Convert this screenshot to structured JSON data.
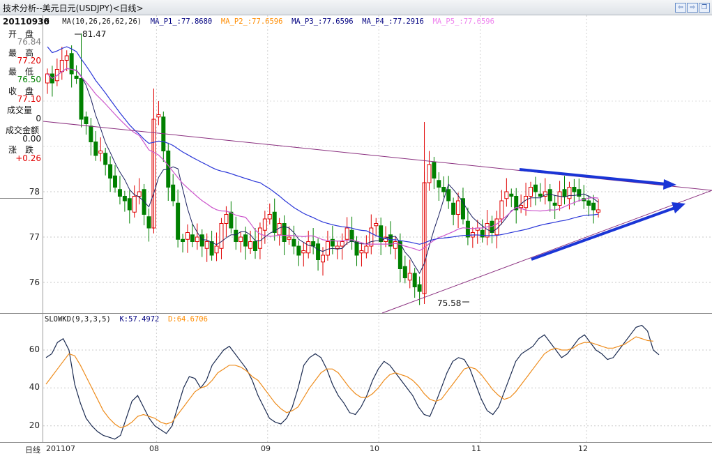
{
  "window": {
    "title": "技术分析--美元日元(USDJPY)<日线>",
    "nav_prev": "⇦",
    "nav_next": "⇨",
    "nav_restore": "❐"
  },
  "info_panel": {
    "date": "20110930",
    "rows": [
      {
        "label": "开　盘",
        "value": "76.84",
        "color": "#808080"
      },
      {
        "label": "最　高",
        "value": "77.20",
        "color": "#e00000"
      },
      {
        "label": "最　低",
        "value": "76.50",
        "color": "#008000"
      },
      {
        "label": "收　盘",
        "value": "77.10",
        "color": "#e00000"
      },
      {
        "label": "成交量",
        "value": "0",
        "color": "#111111"
      },
      {
        "label": "成交金额",
        "value": "0.00",
        "color": "#111111"
      },
      {
        "label": "涨　跌",
        "value": "+0.26",
        "color": "#e00000"
      }
    ]
  },
  "price_legend": {
    "k": "K",
    "ma_params": "MA(10,26,26,62,26)",
    "items": [
      {
        "text": "MA_P1_:77.8680",
        "color": "#000080"
      },
      {
        "text": "MA_P2_:77.6596",
        "color": "#ff8c00"
      },
      {
        "text": "MA_P3_:77.6596",
        "color": "#000080"
      },
      {
        "text": "MA_P4_:77.2916",
        "color": "#000080"
      },
      {
        "text": "MA_P5_:77.6596",
        "color": "#ee82ee"
      }
    ]
  },
  "kd_legend": {
    "params": "SLOWKD(9,3,3,5)",
    "k_text": "K:57.4972",
    "d_text": "D:64.6706",
    "k_color": "#000080",
    "d_color": "#ff8c00"
  },
  "y_ticks_price": [
    "78",
    "77",
    "76"
  ],
  "y_ticks_kd": [
    "60",
    "40",
    "20"
  ],
  "x_axis": {
    "period_label": "日线",
    "labels": [
      "201107",
      "08",
      "09",
      "10",
      "11",
      "12"
    ]
  },
  "annotations": {
    "high_label": "81.47",
    "low_label": "75.58"
  },
  "colors": {
    "up": "#e00000",
    "down": "#008000",
    "ma_fast": "#1a2060",
    "ma_slow": "#2a36d8",
    "ma_mid": "#cc55cc",
    "trend": "#8a2f7f",
    "arrow": "#1a35d6",
    "k_line": "#1a2a50",
    "d_line": "#ee8c1c"
  },
  "chart_data": [
    {
      "type": "candlestick",
      "ylim": [
        75.3,
        81.5
      ],
      "x_months": [
        "201107",
        "08",
        "09",
        "10",
        "11",
        "12"
      ],
      "month_start_index": [
        0,
        23,
        46,
        69,
        90,
        112
      ],
      "series": [
        {
          "name": "MA_P1_",
          "last": 77.868
        },
        {
          "name": "MA_P2_",
          "last": 77.6596
        },
        {
          "name": "MA_P3_",
          "last": 77.6596
        },
        {
          "name": "MA_P4_",
          "last": 77.2916
        },
        {
          "name": "MA_P5_",
          "last": 77.6596
        }
      ],
      "closes": [
        80.6,
        80.4,
        80.7,
        80.9,
        81.0,
        80.6,
        80.5,
        79.6,
        79.5,
        79.1,
        78.8,
        78.9,
        78.6,
        78.3,
        78.1,
        77.9,
        77.8,
        77.6,
        77.9,
        78.0,
        77.5,
        77.2,
        79.6,
        79.7,
        78.9,
        78.1,
        77.8,
        76.95,
        76.9,
        77.1,
        76.9,
        77.0,
        76.8,
        76.9,
        76.6,
        76.8,
        77.3,
        77.5,
        77.2,
        76.9,
        77.0,
        76.8,
        76.9,
        76.7,
        77.2,
        77.4,
        77.5,
        77.1,
        77.3,
        76.9,
        77.0,
        76.8,
        76.6,
        76.7,
        76.9,
        76.8,
        76.5,
        76.6,
        76.9,
        76.8,
        76.8,
        76.9,
        77.2,
        76.9,
        76.6,
        76.7,
        76.8,
        77.2,
        77.3,
        76.9,
        77.0,
        76.8,
        76.9,
        76.3,
        76.1,
        76.2,
        75.9,
        75.8,
        78.2,
        78.6,
        78.3,
        78.1,
        78.0,
        77.8,
        77.5,
        77.8,
        77.4,
        77.0,
        77.1,
        77.2,
        77.0,
        77.3,
        77.1,
        77.4,
        77.8,
        78.0,
        77.9,
        77.6,
        77.7,
        77.9,
        78.1,
        78.0,
        77.9,
        78.0,
        77.8,
        77.7,
        78.0,
        77.9,
        78.1,
        78.0,
        77.9,
        77.8,
        77.7,
        77.6,
        77.6
      ]
    },
    {
      "type": "line",
      "ylim": [
        10,
        75
      ],
      "yticks": [
        20,
        40,
        60
      ],
      "series": [
        {
          "name": "K",
          "last": 57.4972,
          "values": [
            56,
            58,
            64,
            66,
            60,
            42,
            32,
            24,
            20,
            17,
            15,
            14,
            13,
            15,
            24,
            33,
            36,
            30,
            24,
            20,
            18,
            16,
            20,
            30,
            40,
            46,
            45,
            40,
            44,
            52,
            56,
            60,
            62,
            58,
            54,
            50,
            44,
            36,
            30,
            24,
            22,
            21,
            24,
            30,
            40,
            52,
            56,
            58,
            56,
            50,
            42,
            36,
            32,
            27,
            26,
            30,
            36,
            44,
            50,
            54,
            52,
            48,
            44,
            40,
            36,
            30,
            26,
            25,
            32,
            40,
            48,
            54,
            56,
            55,
            50,
            42,
            34,
            28,
            26,
            30,
            38,
            46,
            54,
            58,
            60,
            62,
            66,
            68,
            64,
            60,
            56,
            58,
            62,
            66,
            68,
            64,
            60,
            58,
            55,
            56,
            60,
            64,
            68,
            72,
            73,
            70,
            60,
            57.5
          ]
        },
        {
          "name": "D",
          "last": 64.6706,
          "values": [
            42,
            46,
            50,
            54,
            58,
            57,
            52,
            46,
            40,
            34,
            28,
            24,
            21,
            19,
            20,
            22,
            25,
            26,
            25,
            24,
            22,
            21,
            22,
            26,
            30,
            34,
            38,
            40,
            41,
            44,
            48,
            50,
            52,
            52,
            51,
            49,
            46,
            44,
            40,
            36,
            32,
            29,
            27,
            28,
            30,
            35,
            40,
            44,
            48,
            50,
            50,
            48,
            44,
            40,
            37,
            35,
            35,
            37,
            40,
            44,
            47,
            48,
            47,
            46,
            44,
            41,
            37,
            34,
            33,
            34,
            38,
            42,
            46,
            50,
            51,
            50,
            47,
            43,
            39,
            36,
            34,
            35,
            38,
            42,
            46,
            50,
            54,
            58,
            60,
            61,
            60,
            60,
            61,
            63,
            64,
            64,
            63,
            62,
            61,
            61,
            62,
            63,
            65,
            67,
            66,
            65,
            64.67
          ]
        }
      ]
    }
  ]
}
